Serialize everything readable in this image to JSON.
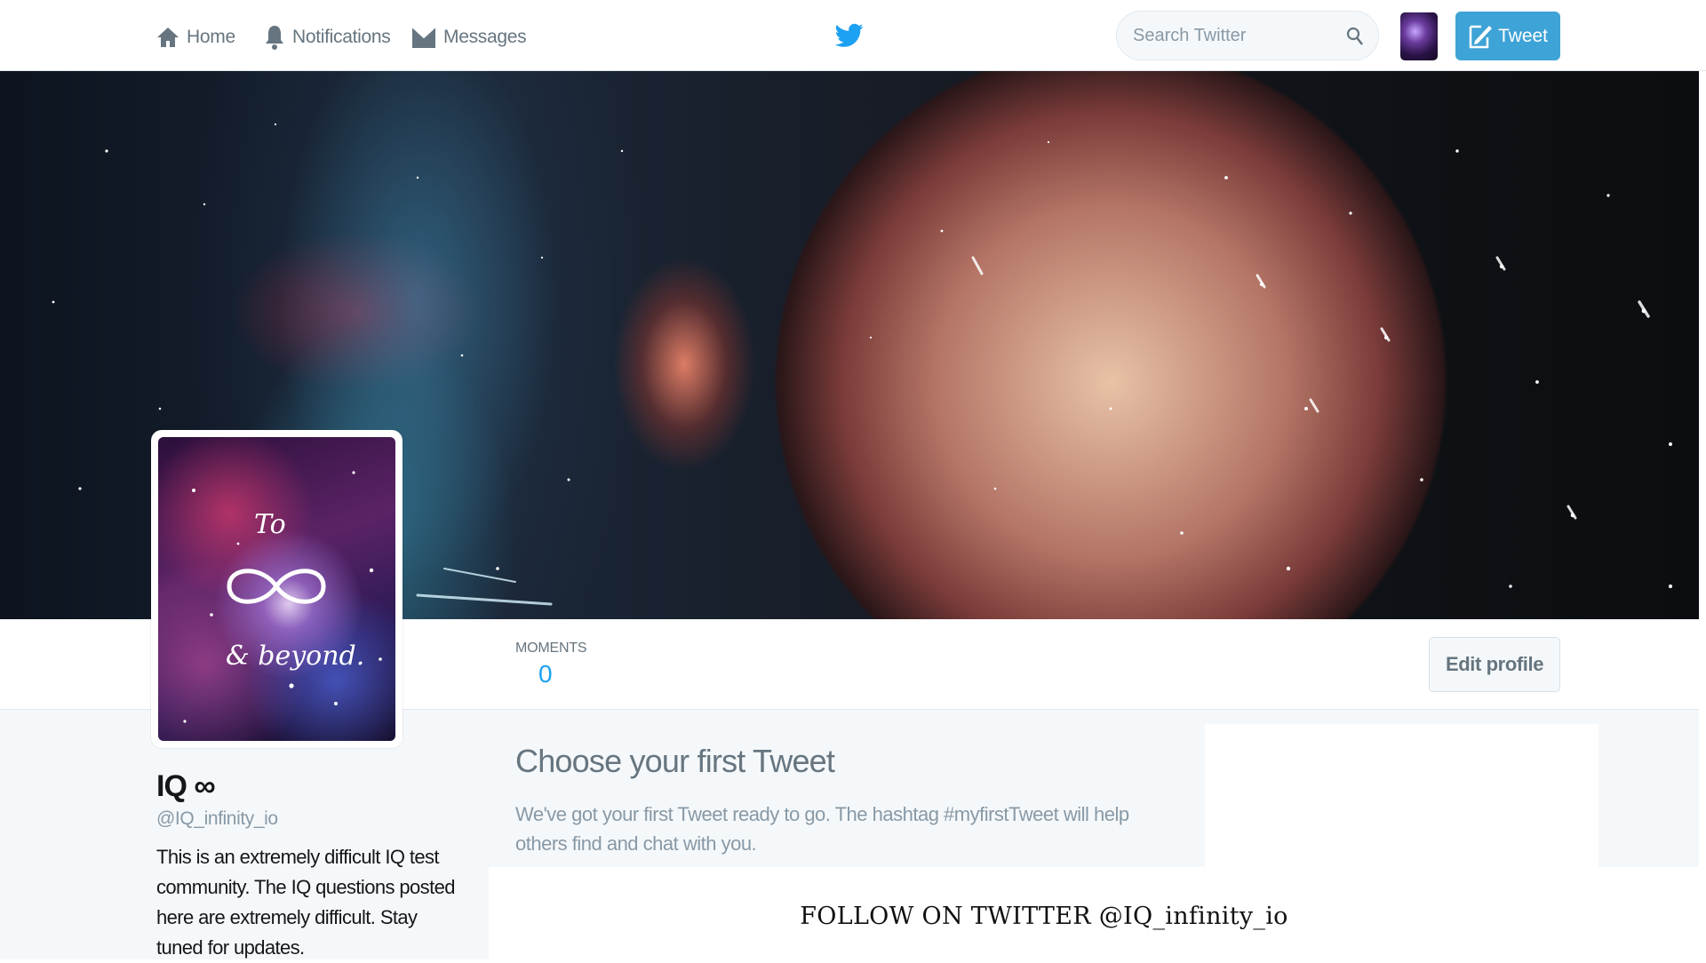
{
  "nav": {
    "home": "Home",
    "notifications": "Notifications",
    "messages": "Messages"
  },
  "search": {
    "placeholder": "Search Twitter"
  },
  "tweet_button": "Tweet",
  "stats": {
    "moments_label": "MOMENTS",
    "moments_count": "0"
  },
  "edit_profile": "Edit profile",
  "profile": {
    "name": "IQ ∞",
    "handle": "@IQ_infinity_io",
    "bio": "This is an extremely difficult IQ test community. The IQ questions posted here are extremely difficult. Stay tuned for updates."
  },
  "avatar_text": {
    "line1": "To",
    "line2": "& beyond."
  },
  "first_tweet": {
    "title": "Choose your first Tweet",
    "description": "We've got your first Tweet ready to go. The hashtag #myfirstTweet will help others find and chat with you."
  },
  "footer_caption": "FOLLOW ON TWITTER @IQ_infinity_io",
  "colors": {
    "accent": "#1da1f2",
    "tweet_button": "#3ea3d6",
    "muted_text": "#66757f",
    "page_bg": "#f5f8fa"
  },
  "icons": [
    "home-icon",
    "bell-icon",
    "envelope-icon",
    "twitter-bird-icon",
    "search-icon",
    "compose-icon"
  ]
}
